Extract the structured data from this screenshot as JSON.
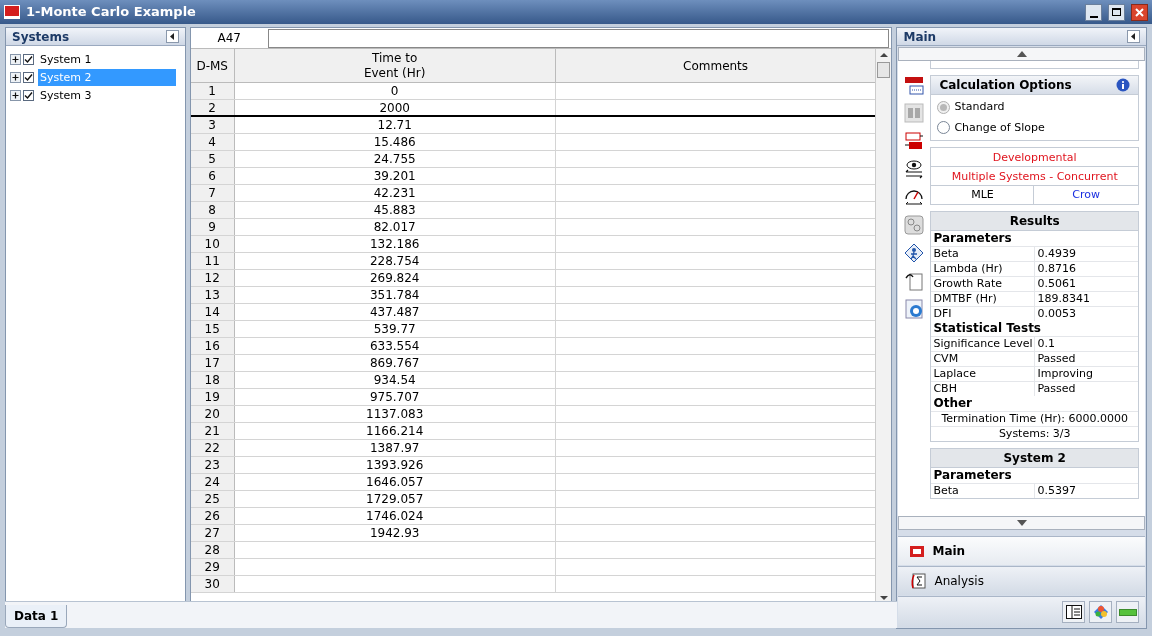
{
  "window": {
    "title": "1-Monte Carlo Example"
  },
  "systems_panel": {
    "title": "Systems",
    "items": [
      {
        "label": "System 1",
        "checked": true,
        "selected": false
      },
      {
        "label": "System 2",
        "checked": true,
        "selected": true
      },
      {
        "label": "System 3",
        "checked": true,
        "selected": false
      }
    ]
  },
  "cell_reference": "A47",
  "table": {
    "columns": [
      "D-MS",
      "Time to\nEvent (Hr)",
      "Comments"
    ],
    "rows": [
      {
        "number": "1",
        "time": "0",
        "divider_below": false
      },
      {
        "number": "2",
        "time": "2000",
        "divider_below": true
      },
      {
        "number": "3",
        "time": "12.71",
        "divider_below": false
      },
      {
        "number": "4",
        "time": "15.486",
        "divider_below": false
      },
      {
        "number": "5",
        "time": "24.755",
        "divider_below": false
      },
      {
        "number": "6",
        "time": "39.201",
        "divider_below": false
      },
      {
        "number": "7",
        "time": "42.231",
        "divider_below": false
      },
      {
        "number": "8",
        "time": "45.883",
        "divider_below": false
      },
      {
        "number": "9",
        "time": "82.017",
        "divider_below": false
      },
      {
        "number": "10",
        "time": "132.186",
        "divider_below": false
      },
      {
        "number": "11",
        "time": "228.754",
        "divider_below": false
      },
      {
        "number": "12",
        "time": "269.824",
        "divider_below": false
      },
      {
        "number": "13",
        "time": "351.784",
        "divider_below": false
      },
      {
        "number": "14",
        "time": "437.487",
        "divider_below": false
      },
      {
        "number": "15",
        "time": "539.77",
        "divider_below": false
      },
      {
        "number": "16",
        "time": "633.554",
        "divider_below": false
      },
      {
        "number": "17",
        "time": "869.767",
        "divider_below": false
      },
      {
        "number": "18",
        "time": "934.54",
        "divider_below": false
      },
      {
        "number": "19",
        "time": "975.707",
        "divider_below": false
      },
      {
        "number": "20",
        "time": "1137.083",
        "divider_below": false
      },
      {
        "number": "21",
        "time": "1166.214",
        "divider_below": false
      },
      {
        "number": "22",
        "time": "1387.97",
        "divider_below": false
      },
      {
        "number": "23",
        "time": "1393.926",
        "divider_below": false
      },
      {
        "number": "24",
        "time": "1646.057",
        "divider_below": false
      },
      {
        "number": "25",
        "time": "1729.057",
        "divider_below": false
      },
      {
        "number": "26",
        "time": "1746.024",
        "divider_below": false
      },
      {
        "number": "27",
        "time": "1942.93",
        "divider_below": false
      },
      {
        "number": "28",
        "divider_below": false
      },
      {
        "number": "29",
        "divider_below": false
      },
      {
        "number": "30",
        "divider_below": false
      }
    ]
  },
  "main_panel": {
    "title": "Main",
    "calculation_options": {
      "title": "Calculation Options",
      "options": [
        {
          "label": "Standard",
          "selected": true,
          "disabled": true
        },
        {
          "label": "Change of Slope",
          "selected": false,
          "disabled": false
        }
      ]
    },
    "model": {
      "type": "Developmental",
      "data_type": "Multiple Systems - Concurrent",
      "method": "MLE",
      "model_name": "Crow"
    },
    "results": {
      "title": "Results",
      "sections": [
        {
          "heading": "Parameters",
          "rows": [
            {
              "label": "Beta",
              "value": "0.4939"
            },
            {
              "label": "Lambda (Hr)",
              "value": "0.8716"
            },
            {
              "label": "Growth Rate",
              "value": "0.5061"
            },
            {
              "label": "DMTBF (Hr)",
              "value": "189.8341"
            },
            {
              "label": "DFI",
              "value": "0.0053"
            }
          ]
        },
        {
          "heading": "Statistical Tests",
          "rows": [
            {
              "label": "Significance Level",
              "value": "0.1"
            },
            {
              "label": "CVM",
              "value": "Passed"
            },
            {
              "label": "Laplace",
              "value": "Improving"
            },
            {
              "label": "CBH",
              "value": "Passed"
            }
          ]
        },
        {
          "heading": "Other",
          "notes": [
            "Termination Time (Hr): 6000.0000",
            "Systems: 3/3"
          ]
        }
      ]
    },
    "system_results": {
      "title": "System 2",
      "sections": [
        {
          "heading": "Parameters",
          "rows": [
            {
              "label": "Beta",
              "value": "0.5397"
            }
          ]
        }
      ]
    }
  },
  "nav": [
    {
      "label": "Main",
      "selected": true
    },
    {
      "label": "Analysis",
      "selected": false
    }
  ],
  "sheet_tabs": [
    {
      "label": "Data 1",
      "selected": true
    }
  ]
}
